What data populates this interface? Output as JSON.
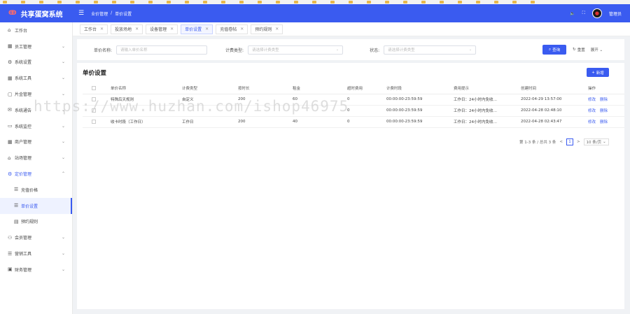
{
  "app": {
    "title": "共享蛋窝系统",
    "user": "管理员"
  },
  "breadcrumb": [
    "业价管理",
    "/",
    "单价设置"
  ],
  "sidebar": {
    "items": [
      {
        "label": "工作台",
        "icon": "home-icon"
      },
      {
        "label": "员工管理",
        "icon": "grid-icon"
      },
      {
        "label": "系统设置",
        "icon": "gear-icon"
      },
      {
        "label": "系统工具",
        "icon": "grid-icon"
      },
      {
        "label": "片金管理",
        "icon": "file-icon"
      },
      {
        "label": "系统通告",
        "icon": "mail-icon"
      },
      {
        "label": "系统监控",
        "icon": "monitor-icon"
      },
      {
        "label": "商户管理",
        "icon": "grid-icon"
      },
      {
        "label": "站场管理",
        "icon": "store-icon"
      },
      {
        "label": "定价管理",
        "icon": "gear-icon"
      },
      {
        "label": "充值价格",
        "icon": "list-icon"
      },
      {
        "label": "单价设置",
        "icon": "list-icon"
      },
      {
        "label": "预约规则",
        "icon": "doc-icon"
      },
      {
        "label": "会员管理",
        "icon": "users-icon"
      },
      {
        "label": "营销工具",
        "icon": "list-icon"
      },
      {
        "label": "财务管理",
        "icon": "money-icon"
      }
    ]
  },
  "tabs": [
    "工作台",
    "投放场地",
    "设备管理",
    "单价设置",
    "充值卷帖",
    "预约规则"
  ],
  "filter": {
    "name_label": "单价名称:",
    "name_placeholder": "请输入单价名称",
    "type_label": "计费类型:",
    "type_placeholder": "请选择计费类型",
    "status_label": "状态:",
    "status_placeholder": "请选择计费类型",
    "query": "查询",
    "reset": "重置",
    "expand": "展开"
  },
  "panel": {
    "title": "单价设置",
    "add": "新增"
  },
  "table": {
    "headers": [
      "单价名称",
      "计费类型",
      "按时长",
      "租金",
      "超时费用",
      "计费时段",
      "费用提示",
      "创建时间",
      "操作"
    ],
    "rows": [
      [
        "特殊后天规则",
        "自定义",
        "200",
        "60",
        "0",
        "00:00:00-23:59:59",
        "工作日：24小时内免收…",
        "2022-04-29 13:57:00",
        "修改",
        "删除"
      ],
      [
        "",
        "",
        "",
        "",
        "0",
        "00:00:00-23:59:59",
        "工作日：24小时内免收…",
        "2022-04-28 02:48:10",
        "修改",
        "删除"
      ],
      [
        "收卡时段（工作日）",
        "工作日",
        "200",
        "40",
        "0",
        "00:00:00-23:59:59",
        "工作日：24小时内免收…",
        "2022-04-28 02:43:47",
        "修改",
        "删除"
      ]
    ]
  },
  "pager": {
    "summary": "第 1-3 条 / 总共 3 条",
    "prev": "<",
    "page": "1",
    "next": ">",
    "size": "10 条/页"
  },
  "watermark": "https://www.huzhan.com/ishop46975"
}
